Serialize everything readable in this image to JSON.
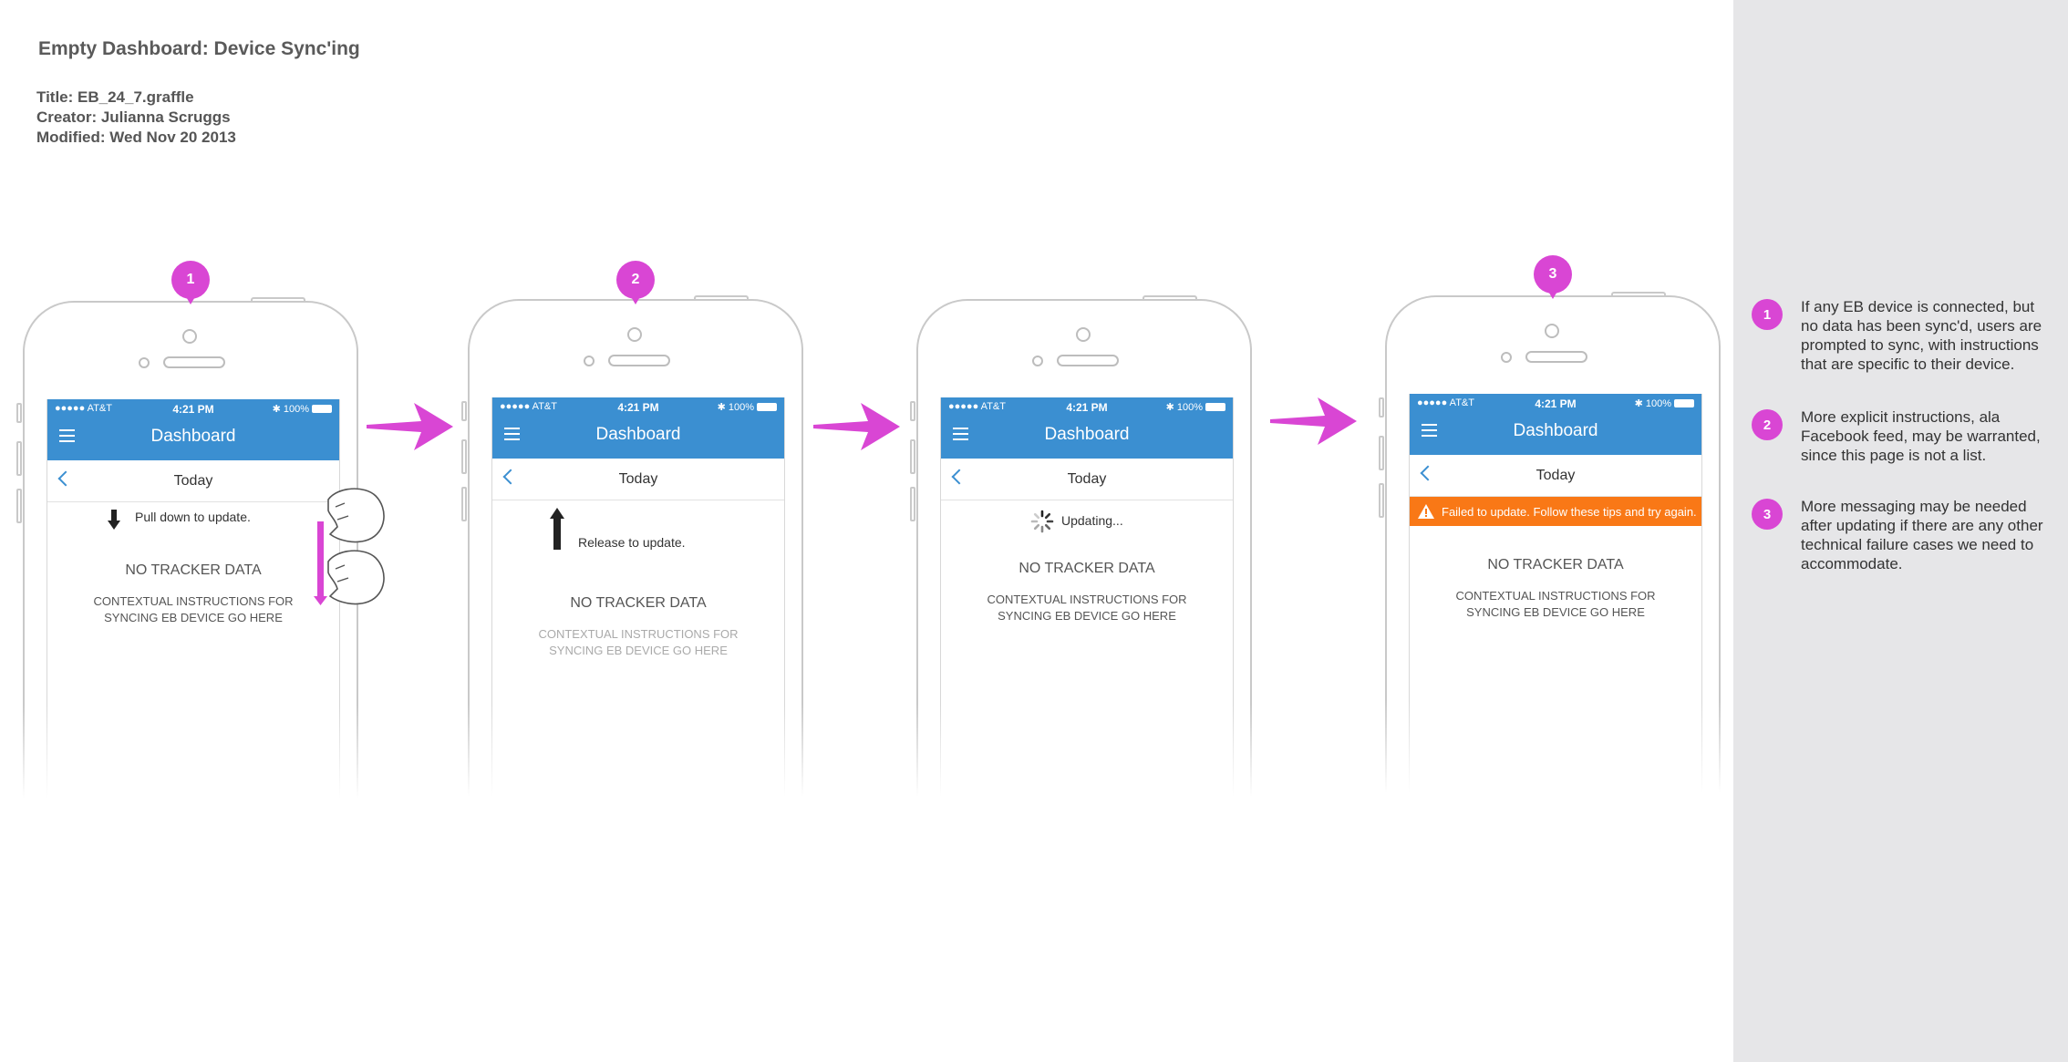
{
  "document": {
    "title": "Empty Dashboard: Device Sync'ing",
    "meta_title": "Title: EB_24_7.graffle",
    "meta_creator": "Creator: Julianna Scruggs",
    "meta_modified": "Modified: Wed Nov 20 2013"
  },
  "accent_color": "#d946d4",
  "header_color": "#3b8fd1",
  "error_color": "#f97816",
  "status": {
    "carrier": "●●●●● AT&T",
    "time": "4:21 PM",
    "battery": "100%"
  },
  "app": {
    "title": "Dashboard",
    "date_label": "Today",
    "no_data": "NO TRACKER DATA",
    "instructions": "CONTEXTUAL INSTRUCTIONS FOR SYNCING EB DEVICE GO HERE"
  },
  "screens": {
    "pull": "Pull down to update.",
    "release": "Release to update.",
    "updating": "Updating...",
    "failed": "Failed to update. Follow these tips and try again."
  },
  "pins": [
    "1",
    "2",
    "3"
  ],
  "notes": [
    {
      "num": "1",
      "text": "If any EB device is connected, but no data has been sync'd, users are prompted to sync, with instructions that are specific to their device."
    },
    {
      "num": "2",
      "text": "More explicit instructions, ala Facebook feed, may be warranted, since this page is not a list."
    },
    {
      "num": "3",
      "text": "More messaging may be needed after updating if there are any other technical failure cases we need to accommodate."
    }
  ]
}
